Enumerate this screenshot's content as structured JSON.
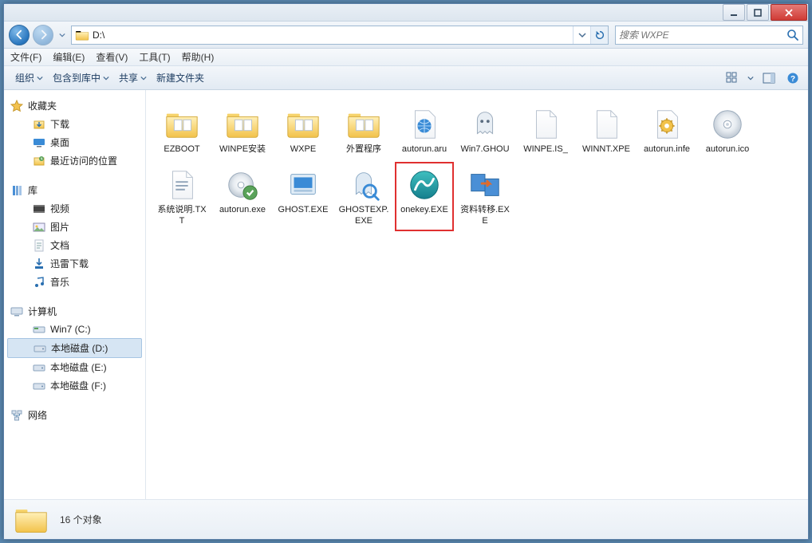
{
  "address": {
    "path": "D:\\"
  },
  "search": {
    "placeholder": "搜索 WXPE"
  },
  "menus": [
    "文件(F)",
    "编辑(E)",
    "查看(V)",
    "工具(T)",
    "帮助(H)"
  ],
  "toolbar": {
    "organize": "组织",
    "include": "包含到库中",
    "share": "共享",
    "newfolder": "新建文件夹"
  },
  "sidebar": {
    "favorites": {
      "label": "收藏夹",
      "items": [
        {
          "key": "downloads",
          "label": "下载"
        },
        {
          "key": "desktop",
          "label": "桌面"
        },
        {
          "key": "recent",
          "label": "最近访问的位置"
        }
      ]
    },
    "libraries": {
      "label": "库",
      "items": [
        {
          "key": "videos",
          "label": "视频"
        },
        {
          "key": "pictures",
          "label": "图片"
        },
        {
          "key": "documents",
          "label": "文档"
        },
        {
          "key": "xunlei",
          "label": "迅雷下载"
        },
        {
          "key": "music",
          "label": "音乐"
        }
      ]
    },
    "computer": {
      "label": "计算机",
      "items": [
        {
          "key": "c",
          "label": "Win7 (C:)"
        },
        {
          "key": "d",
          "label": "本地磁盘 (D:)",
          "selected": true
        },
        {
          "key": "e",
          "label": "本地磁盘 (E:)"
        },
        {
          "key": "f",
          "label": "本地磁盘 (F:)"
        }
      ]
    },
    "network": {
      "label": "网络"
    }
  },
  "files": [
    {
      "name": "EZBOOT",
      "type": "folder-pages"
    },
    {
      "name": "WINPE安装",
      "type": "folder-pages"
    },
    {
      "name": "WXPE",
      "type": "folder-pages"
    },
    {
      "name": "外置程序",
      "type": "folder-pages"
    },
    {
      "name": "autorun.aru",
      "type": "globe-page"
    },
    {
      "name": "Win7.GHOU",
      "type": "ghost"
    },
    {
      "name": "WINPE.IS_",
      "type": "page"
    },
    {
      "name": "WINNT.XPE",
      "type": "page"
    },
    {
      "name": "autorun.infe",
      "type": "gear-page"
    },
    {
      "name": "autorun.ico",
      "type": "disc"
    },
    {
      "name": "系统说明.TXT",
      "type": "txt"
    },
    {
      "name": "autorun.exe",
      "type": "disc-green"
    },
    {
      "name": "GHOST.EXE",
      "type": "ghost-app"
    },
    {
      "name": "GHOSTEXP.EXE",
      "type": "ghost-exp"
    },
    {
      "name": "onekey.EXE",
      "type": "onekey",
      "highlight": true
    },
    {
      "name": "资料转移.EXE",
      "type": "transfer"
    }
  ],
  "status": {
    "count_label": "16 个对象"
  }
}
